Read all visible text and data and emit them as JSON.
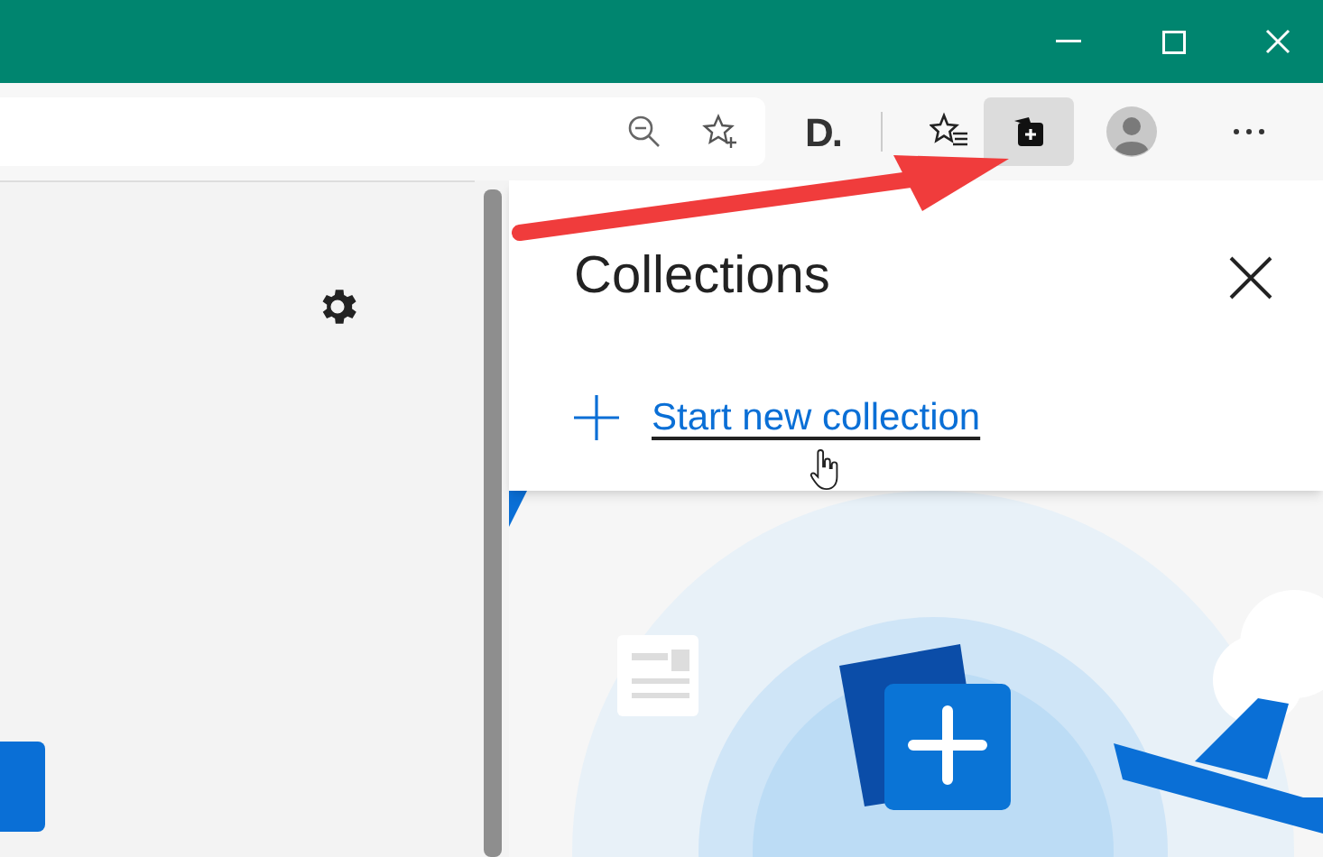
{
  "toolbar": {
    "extension_label": "D.",
    "collections_button": {
      "active": true
    }
  },
  "collections_panel": {
    "title": "Collections",
    "action": "Start new collection"
  }
}
